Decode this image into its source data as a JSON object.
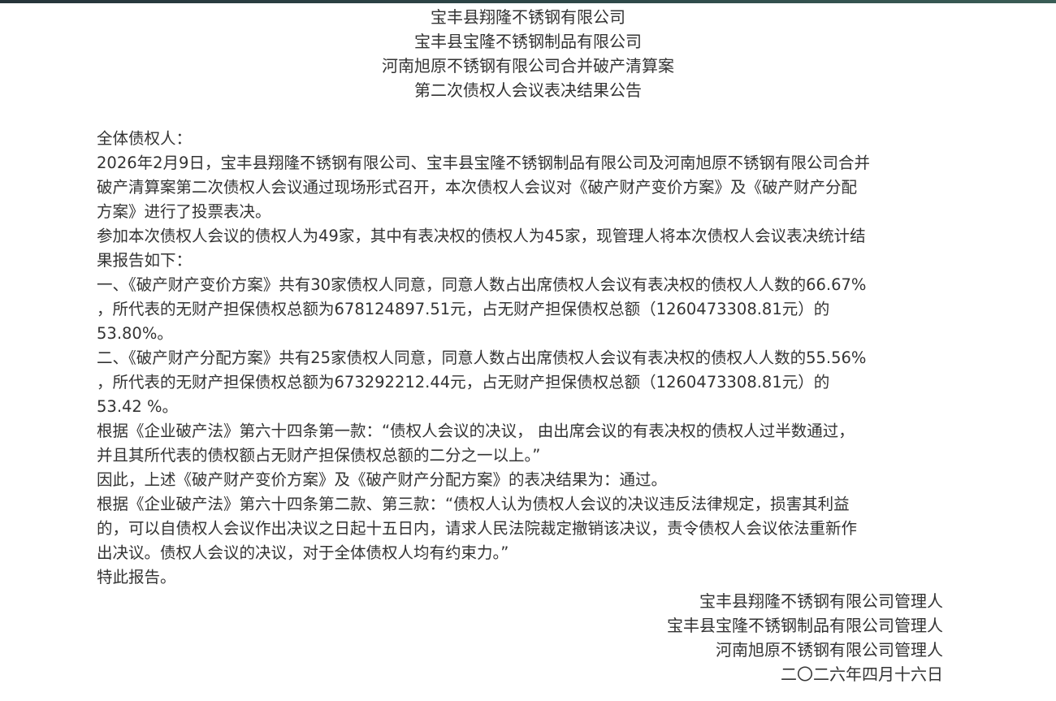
{
  "header": {
    "lines": [
      "宝丰县翔隆不锈钢有限公司",
      "宝丰县宝隆不锈钢制品有限公司",
      "河南旭原不锈钢有限公司合并破产清算案",
      "第二次债权人会议表决结果公告"
    ]
  },
  "body": {
    "lines": [
      "全体债权人：",
      "2026年2月9日，宝丰县翔隆不锈钢有限公司、宝丰县宝隆不锈钢制品有限公司及河南旭原不锈钢有限公司合并",
      "破产清算案第二次债权人会议通过现场形式召开，本次债权人会议对《破产财产变价方案》及《破产财产分配",
      "方案》进行了投票表决。",
      "参加本次债权人会议的债权人为49家，其中有表决权的债权人为45家，现管理人将本次债权人会议表决统计结",
      "果报告如下：",
      "一、《破产财产变价方案》共有30家债权人同意，同意人数占出席债权人会议有表决权的债权人人数的66.67%",
      "，所代表的无财产担保债权总额为678124897.51元，占无财产担保债权总额（1260473308.81元）的",
      "53.80%。",
      "二、《破产财产分配方案》共有25家债权人同意，同意人数占出席债权人会议有表决权的债权人人数的55.56%",
      "，所代表的无财产担保债权总额为673292212.44元，占无财产担保债权总额（1260473308.81元）的",
      "53.42 %。",
      "根据《企业破产法》第六十四条第一款：“债权人会议的决议， 由出席会议的有表决权的债权人过半数通过，",
      "并且其所代表的债权额占无财产担保债权总额的二分之一以上。”",
      "因此，上述《破产财产变价方案》及《破产财产分配方案》的表决结果为：通过。",
      "根据《企业破产法》第六十四条第二款、第三款：“债权人认为债权人会议的决议违反法律规定，损害其利益",
      "的，可以自债权人会议作出决议之日起十五日内，请求人民法院裁定撤销该决议，责令债权人会议依法重新作",
      "出决议。债权人会议的决议，对于全体债权人均有约束力。”",
      "特此报告。"
    ]
  },
  "signature": {
    "lines": [
      "宝丰县翔隆不锈钢有限公司管理人",
      "宝丰县宝隆不锈钢制品有限公司管理人",
      "河南旭原不锈钢有限公司管理人",
      "二〇二六年四月十六日"
    ]
  },
  "colors": {
    "text": "#333333",
    "top_bar": "#2f4a4a",
    "background": "#ffffff"
  }
}
